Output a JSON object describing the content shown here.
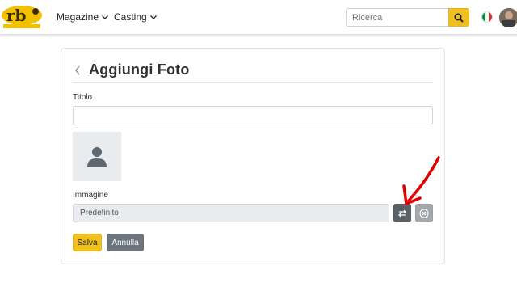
{
  "navbar": {
    "logo_text": "rb",
    "menu": [
      {
        "label": "Magazine"
      },
      {
        "label": "Casting"
      }
    ],
    "search": {
      "placeholder": "Ricerca",
      "value": ""
    },
    "language_flag": "italy-flag-icon"
  },
  "form": {
    "title": "Aggiungi Foto",
    "titolo_label": "Titolo",
    "titolo_value": "",
    "immagine_label": "Immagine",
    "immagine_value": "Predefinito",
    "save_label": "Salva",
    "cancel_label": "Annulla"
  },
  "colors": {
    "accent": "#f0c020",
    "secondary": "#6c757d",
    "annotation": "#e00000"
  }
}
